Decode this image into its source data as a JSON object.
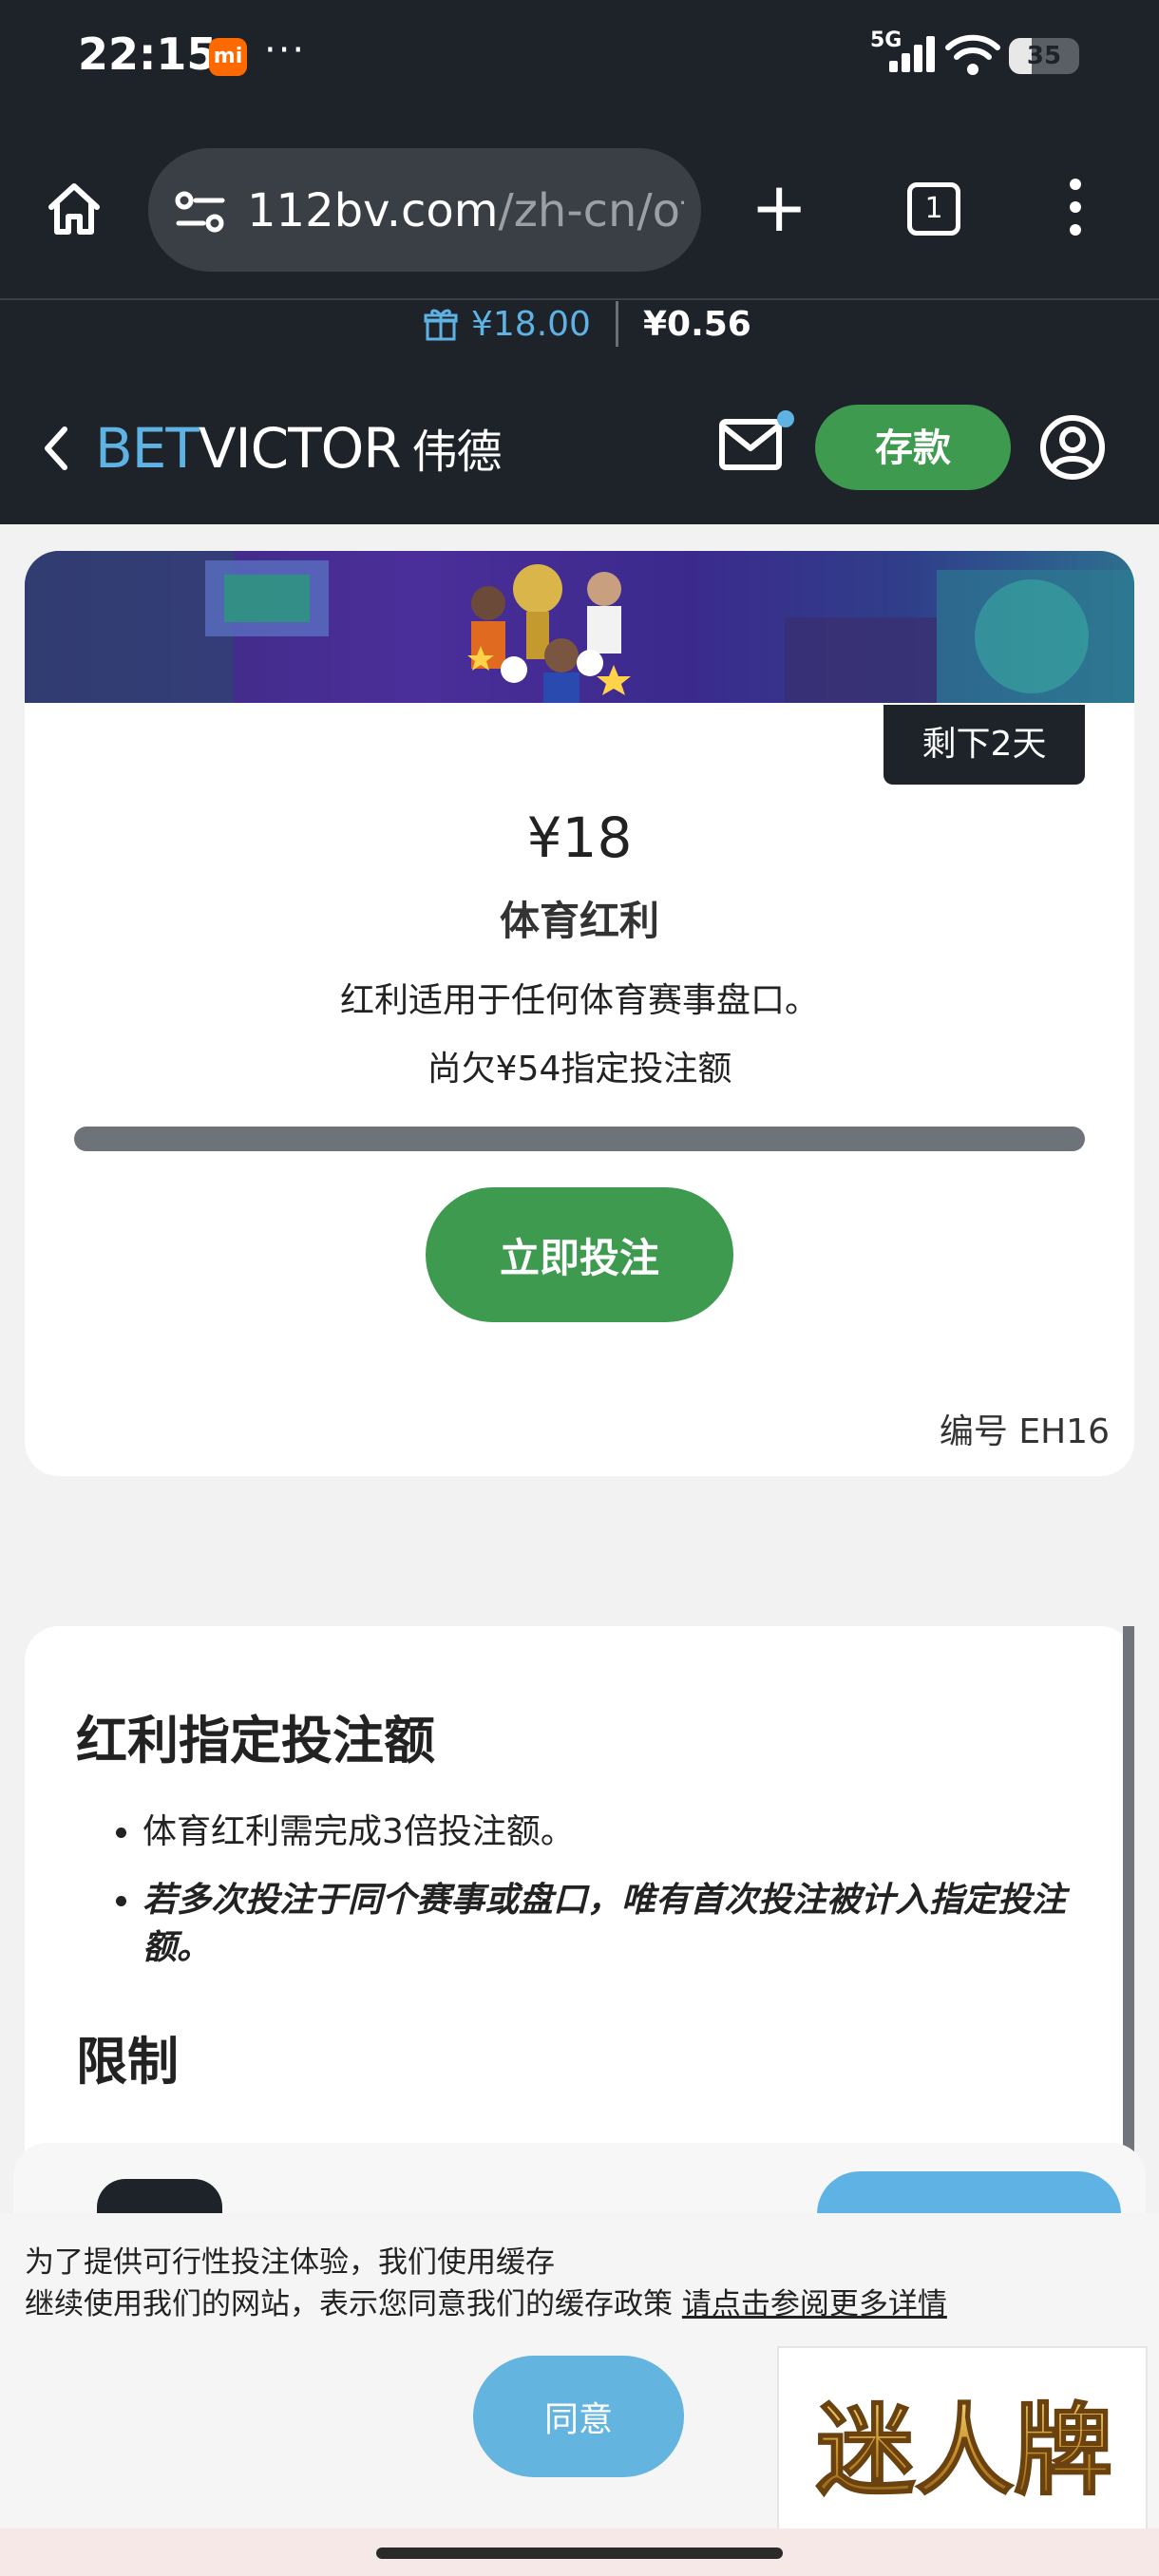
{
  "status_bar": {
    "time": "22:15",
    "mi_label": "mi",
    "dots": "···",
    "network": "5G",
    "battery": "35"
  },
  "browser": {
    "url_domain": "112bv.com",
    "url_path": "/zh-cn/of",
    "tab_count": "1"
  },
  "header": {
    "bonus_balance": "¥18.00",
    "cash_balance": "¥0.56",
    "logo_bet": "BET",
    "logo_victor": "VICTOR",
    "logo_cn": "伟德",
    "deposit_label": "存款",
    "brand_blue": "#5eb3e4",
    "brand_green": "#3d9a4f"
  },
  "offer": {
    "days_left": "剩下2天",
    "amount": "¥18",
    "title": "体育红利",
    "description": "红利适用于任何体育赛事盘口。",
    "remaining": "尚欠¥54指定投注额",
    "progress": 0,
    "bet_button": "立即投注",
    "code": "编号 EH16"
  },
  "terms": {
    "heading": "红利指定投注额",
    "items": [
      "体育红利需完成3倍投注额。",
      "若多次投注于同个赛事或盘口，唯有首次投注被计入指定投注额。"
    ],
    "restrictions_heading": "限制"
  },
  "cookie": {
    "line1": "为了提供可行性投注体验，我们使用缓存",
    "line2": "继续使用我们的网站，表示您同意我们的缓存政策 ",
    "link": "请点击参阅更多详情",
    "agree": "同意"
  },
  "watermark": {
    "text": "迷人牌"
  }
}
